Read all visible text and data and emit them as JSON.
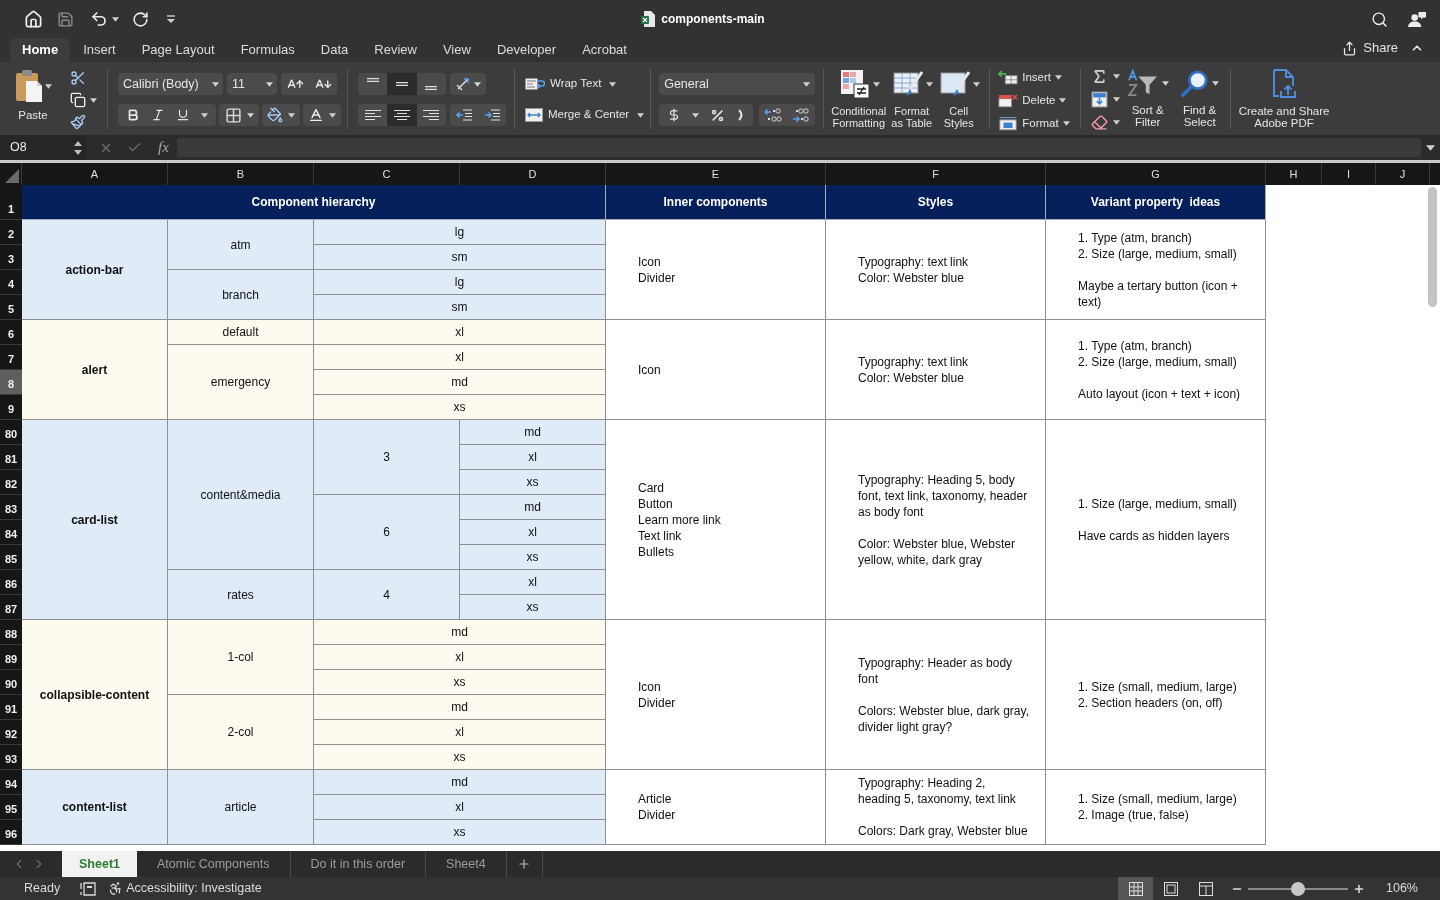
{
  "title_bar": {
    "title": "components-main"
  },
  "ribbon_tabs": [
    {
      "label": "Home",
      "selected": true
    },
    {
      "label": "Insert",
      "selected": false
    },
    {
      "label": "Page Layout",
      "selected": false
    },
    {
      "label": "Formulas",
      "selected": false
    },
    {
      "label": "Data",
      "selected": false
    },
    {
      "label": "Review",
      "selected": false
    },
    {
      "label": "View",
      "selected": false
    },
    {
      "label": "Developer",
      "selected": false
    },
    {
      "label": "Acrobat",
      "selected": false
    }
  ],
  "share": {
    "label": "Share"
  },
  "ribbon": {
    "paste": {
      "label": "Paste"
    },
    "font_name": "Calibri (Body)",
    "font_size": "11",
    "vertical_align": [
      {
        "kind": "top",
        "selected": false
      },
      {
        "kind": "middle",
        "selected": true
      },
      {
        "kind": "bottom",
        "selected": false
      }
    ],
    "horizontal_align": [
      {
        "kind": "left",
        "selected": false
      },
      {
        "kind": "center",
        "selected": true
      },
      {
        "kind": "right",
        "selected": false
      }
    ],
    "wrap_text": "Wrap Text",
    "merge_center": "Merge & Center",
    "number_format": "General",
    "style_buttons": [
      {
        "kind": "conditional",
        "label": "Conditional\nFormatting"
      },
      {
        "kind": "table",
        "label": "Format\nas Table"
      },
      {
        "kind": "cell",
        "label": "Cell\nStyles"
      }
    ],
    "cell_buttons": [
      {
        "kind": "insert",
        "label": "Insert"
      },
      {
        "kind": "delete",
        "label": "Delete"
      },
      {
        "kind": "format",
        "label": "Format"
      }
    ],
    "editing_buttons": [
      {
        "kind": "sort",
        "label": "Sort &\nFilter"
      },
      {
        "kind": "find",
        "label": "Find &\nSelect"
      }
    ],
    "pdf_button": {
      "label": "Create and Share\nAdobe PDF"
    }
  },
  "formula_bar": {
    "name_box": "O8",
    "function_label": "fx"
  },
  "columns": [
    "A",
    "B",
    "C",
    "D",
    "E",
    "F",
    "G",
    "H",
    "I",
    "J"
  ],
  "row_headers": [
    {
      "label": "1",
      "selected": false
    },
    {
      "label": "2",
      "selected": false
    },
    {
      "label": "3",
      "selected": false
    },
    {
      "label": "4",
      "selected": false
    },
    {
      "label": "5",
      "selected": false
    },
    {
      "label": "6",
      "selected": false
    },
    {
      "label": "7",
      "selected": false
    },
    {
      "label": "8",
      "selected": true
    },
    {
      "label": "9",
      "selected": false
    },
    {
      "label": "80",
      "selected": false
    },
    {
      "label": "81",
      "selected": false
    },
    {
      "label": "82",
      "selected": false
    },
    {
      "label": "83",
      "selected": false
    },
    {
      "label": "84",
      "selected": false
    },
    {
      "label": "85",
      "selected": false
    },
    {
      "label": "86",
      "selected": false
    },
    {
      "label": "87",
      "selected": false
    },
    {
      "label": "88",
      "selected": false
    },
    {
      "label": "89",
      "selected": false
    },
    {
      "label": "90",
      "selected": false
    },
    {
      "label": "91",
      "selected": false
    },
    {
      "label": "92",
      "selected": false
    },
    {
      "label": "93",
      "selected": false
    },
    {
      "label": "94",
      "selected": false
    },
    {
      "label": "95",
      "selected": false
    },
    {
      "label": "96",
      "selected": false
    }
  ],
  "table": {
    "header": {
      "hierarchy": "Component hierarchy",
      "inner_components": "Inner components",
      "styles": "Styles",
      "variant_ideas": "Variant property  ideas"
    },
    "components": [
      {
        "name": "action-bar",
        "color": "#dfebf7",
        "children": [
          {
            "name": "atm",
            "children": [
              {
                "name": "lg"
              },
              {
                "name": "sm"
              }
            ]
          },
          {
            "name": "branch",
            "children": [
              {
                "name": "lg"
              },
              {
                "name": "sm"
              }
            ]
          }
        ],
        "inner_components": [
          "Icon",
          "Divider"
        ],
        "styles": [
          [
            "Typography: text link",
            "Color: Webster blue"
          ]
        ],
        "variant_ideas": [
          [
            "1. Type (atm, branch)",
            "2. Size (large, medium, small)"
          ],
          [
            "Maybe a tertary button (icon + text)"
          ]
        ]
      },
      {
        "name": "alert",
        "color": "#fdfbef",
        "children": [
          {
            "name": "default",
            "children": [
              {
                "name": "xl"
              }
            ]
          },
          {
            "name": "emergency",
            "children": [
              {
                "name": "xl"
              },
              {
                "name": "md"
              },
              {
                "name": "xs"
              }
            ]
          }
        ],
        "inner_components": [
          "Icon"
        ],
        "styles": [
          [
            "Typography: text link",
            "Color: Webster blue"
          ]
        ],
        "variant_ideas": [
          [
            "1. Type (atm, branch)",
            "2. Size (large, medium, small)"
          ],
          [
            "Auto layout (icon + text + icon)"
          ]
        ]
      },
      {
        "name": "card-list",
        "color": "#dfebf7",
        "children": [
          {
            "name": "content&media",
            "children": [
              {
                "name": "3",
                "children": [
                  {
                    "name": "md"
                  },
                  {
                    "name": "xl"
                  },
                  {
                    "name": "xs"
                  }
                ]
              },
              {
                "name": "6",
                "children": [
                  {
                    "name": "md"
                  },
                  {
                    "name": "xl"
                  },
                  {
                    "name": "xs"
                  }
                ]
              }
            ]
          },
          {
            "name": "rates",
            "children": [
              {
                "name": "4",
                "children": [
                  {
                    "name": "xl"
                  },
                  {
                    "name": "xs"
                  }
                ]
              }
            ]
          }
        ],
        "inner_components": [
          "Card",
          "Button",
          "Learn more link",
          "Text link",
          "Bullets"
        ],
        "styles": [
          [
            "Typography: Heading 5, body font, text link, taxonomy, header as body font"
          ],
          [
            "Color: Webster blue, Webster yellow, white, dark gray"
          ]
        ],
        "variant_ideas": [
          [
            "1. Size (large, medium, small)"
          ],
          [
            "Have cards as hidden layers"
          ]
        ]
      },
      {
        "name": "collapsible-content",
        "color": "#fdfbef",
        "children": [
          {
            "name": "1-col",
            "children": [
              {
                "name": "md"
              },
              {
                "name": "xl"
              },
              {
                "name": "xs"
              }
            ]
          },
          {
            "name": "2-col",
            "children": [
              {
                "name": "md"
              },
              {
                "name": "xl"
              },
              {
                "name": "xs"
              }
            ]
          }
        ],
        "inner_components": [
          "Icon",
          "Divider"
        ],
        "styles": [
          [
            "Typography: Header as body font"
          ],
          [
            "Colors: Webster blue, dark gray, divider light gray?"
          ]
        ],
        "variant_ideas": [
          [
            "1. Size (small, medium, large)",
            "2. Section headers (on, off)"
          ]
        ]
      },
      {
        "name": "content-list",
        "color": "#dfebf7",
        "children": [
          {
            "name": "article",
            "children": [
              {
                "name": "md"
              },
              {
                "name": "xl"
              },
              {
                "name": "xs"
              }
            ]
          }
        ],
        "inner_components": [
          "Article",
          "Divider"
        ],
        "styles": [
          [
            "Typography: Heading 2, heading 5, taxonomy, text link"
          ],
          [
            "Colors: Dark gray, Webster blue"
          ]
        ],
        "variant_ideas": [
          [
            "1. Size (small, medium, large)",
            "2. Image (true, false)"
          ]
        ]
      }
    ]
  },
  "sheet_tabs": [
    {
      "label": "Sheet1",
      "selected": true
    },
    {
      "label": "Atomic Components",
      "selected": false
    },
    {
      "label": "Do it in this order",
      "selected": false
    },
    {
      "label": "Sheet4",
      "selected": false
    }
  ],
  "status_bar": {
    "status": "Ready",
    "accessibility": "Accessibility: Investigate",
    "views": [
      {
        "kind": "normal",
        "selected": true
      },
      {
        "kind": "page_layout",
        "selected": false
      },
      {
        "kind": "page_break",
        "selected": false
      }
    ],
    "zoom": {
      "level": 0.5,
      "reading": "106%"
    }
  }
}
